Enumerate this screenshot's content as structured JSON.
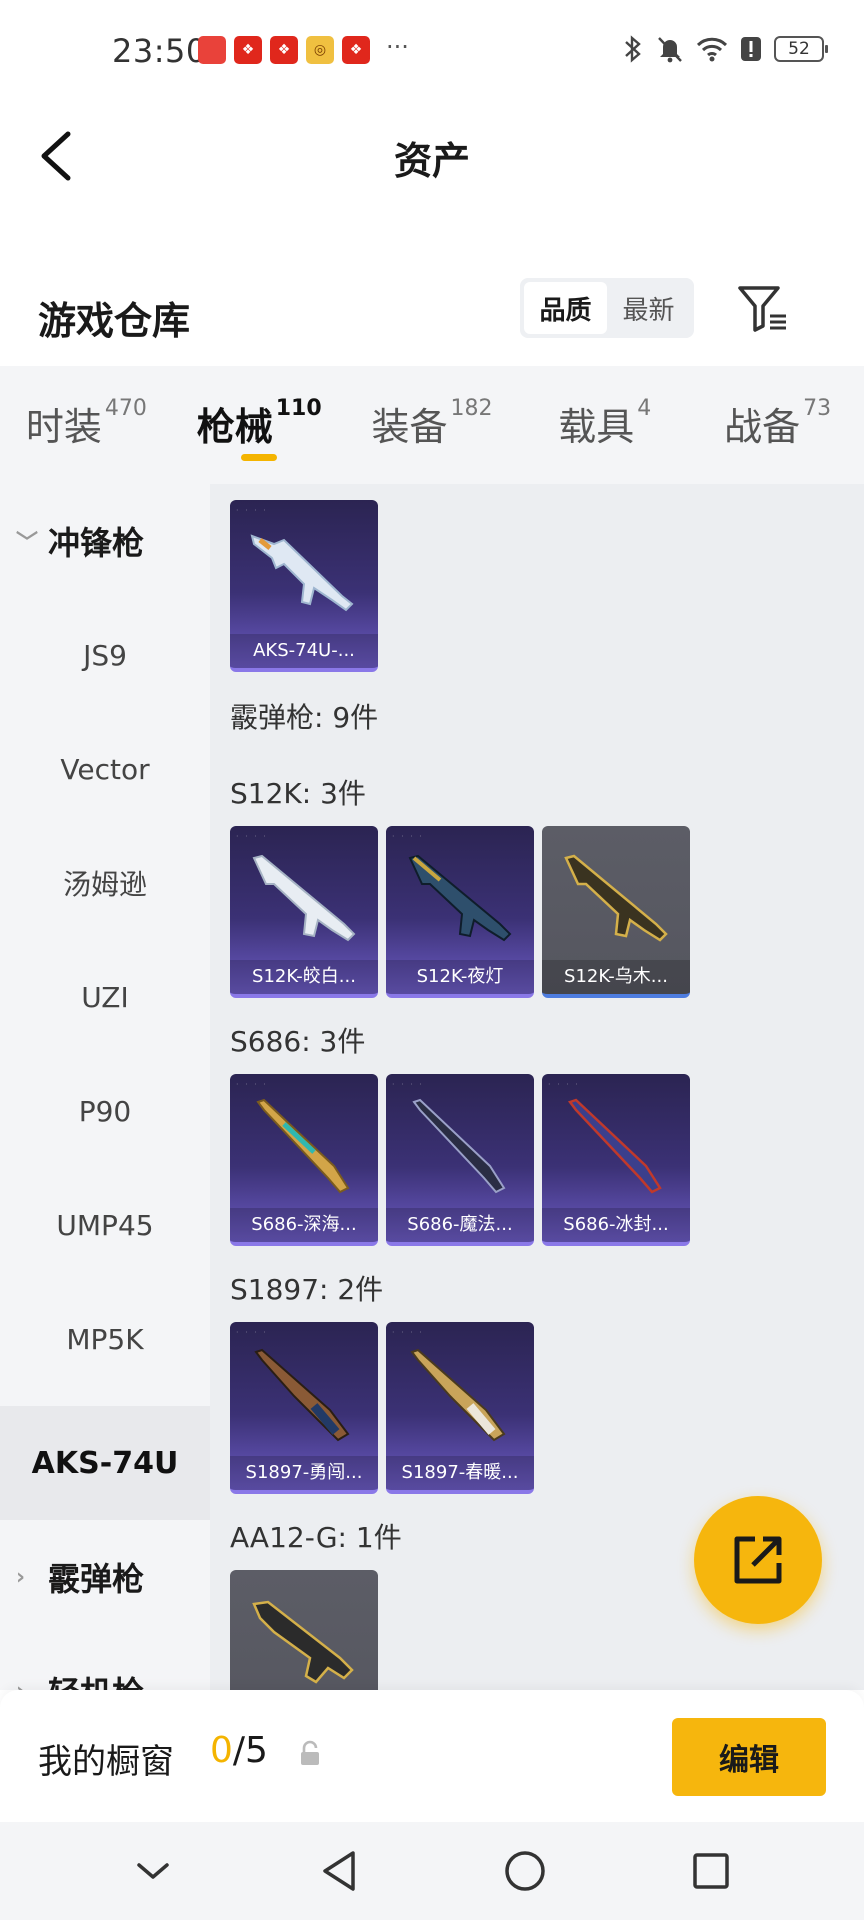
{
  "status_bar": {
    "time": "23:50",
    "battery": "52"
  },
  "header": {
    "title": "资产"
  },
  "warehouse": {
    "title": "游戏仓库",
    "sort_options": [
      "品质",
      "最新"
    ],
    "active_sort": "品质"
  },
  "tabs": [
    {
      "label": "时装",
      "count": "470"
    },
    {
      "label": "枪械",
      "count": "110",
      "active": true
    },
    {
      "label": "装备",
      "count": "182"
    },
    {
      "label": "载具",
      "count": "4"
    },
    {
      "label": "战备",
      "count": "73"
    }
  ],
  "sidebar": {
    "items": [
      {
        "label": "冲锋枪",
        "type": "group",
        "expanded": true
      },
      {
        "label": "JS9"
      },
      {
        "label": "Vector"
      },
      {
        "label": "汤姆逊"
      },
      {
        "label": "UZI"
      },
      {
        "label": "P90"
      },
      {
        "label": "UMP45"
      },
      {
        "label": "MP5K"
      },
      {
        "label": "AKS-74U",
        "selected": true
      },
      {
        "label": "霰弹枪",
        "type": "group",
        "expanded": false
      },
      {
        "label": "轻机枪",
        "type": "group",
        "expanded": false
      }
    ]
  },
  "main": {
    "top_card": {
      "label": "AKS-74U-..."
    },
    "shotgun_summary": "霰弹枪: 9件",
    "sections": [
      {
        "label": "S12K: 3件",
        "cards": [
          {
            "label": "S12K-皎白..."
          },
          {
            "label": "S12K-夜灯"
          },
          {
            "label": "S12K-乌木..."
          }
        ]
      },
      {
        "label": "S686: 3件",
        "cards": [
          {
            "label": "S686-深海..."
          },
          {
            "label": "S686-魔法..."
          },
          {
            "label": "S686-冰封..."
          }
        ]
      },
      {
        "label": "S1897: 2件",
        "cards": [
          {
            "label": "S1897-勇闯..."
          },
          {
            "label": "S1897-春暖..."
          }
        ]
      },
      {
        "label": "AA12-G: 1件",
        "cards": [
          {
            "label": ""
          }
        ]
      }
    ]
  },
  "showcase": {
    "title": "我的橱窗",
    "current": "0",
    "separator": "/",
    "max": "5",
    "edit_label": "编辑"
  },
  "colors": {
    "accent": "#f6b60d",
    "card_purple": "#3b3175",
    "card_gray": "#5c5d66"
  }
}
